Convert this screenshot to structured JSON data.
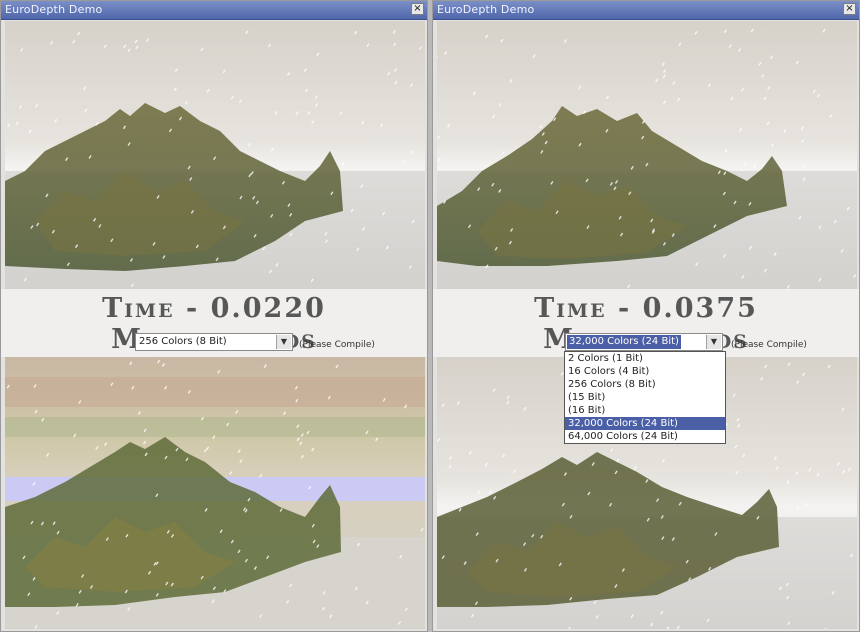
{
  "windows": [
    {
      "title": "EuroDepth Demo",
      "close_label": "×",
      "time_text": "Time - 0.0220 Milliseconds",
      "color_select": {
        "value": "256 Colors (8 Bit)"
      },
      "compile_note": "(Please Compile)"
    },
    {
      "title": "EuroDepth Demo",
      "close_label": "×",
      "time_text": "Time - 0.0375 Milliseconds",
      "color_select": {
        "value": "32,000 Colors (24 Bit)"
      },
      "compile_note": "(Please Compile)",
      "dropdown": {
        "open": true,
        "options": [
          "2 Colors (1 Bit)",
          "16 Colors (4 Bit)",
          "256 Colors (8 Bit)",
          "(15 Bit)",
          "(16 Bit)",
          "32,000 Colors (24 Bit)",
          "64,000 Colors (24 Bit)"
        ],
        "selected_index": 5
      }
    }
  ],
  "colors": {
    "titlebar": "#5a6fb4",
    "selection": "#4a5fa6",
    "time_text": "#575757",
    "terrain": "#5e6132"
  }
}
